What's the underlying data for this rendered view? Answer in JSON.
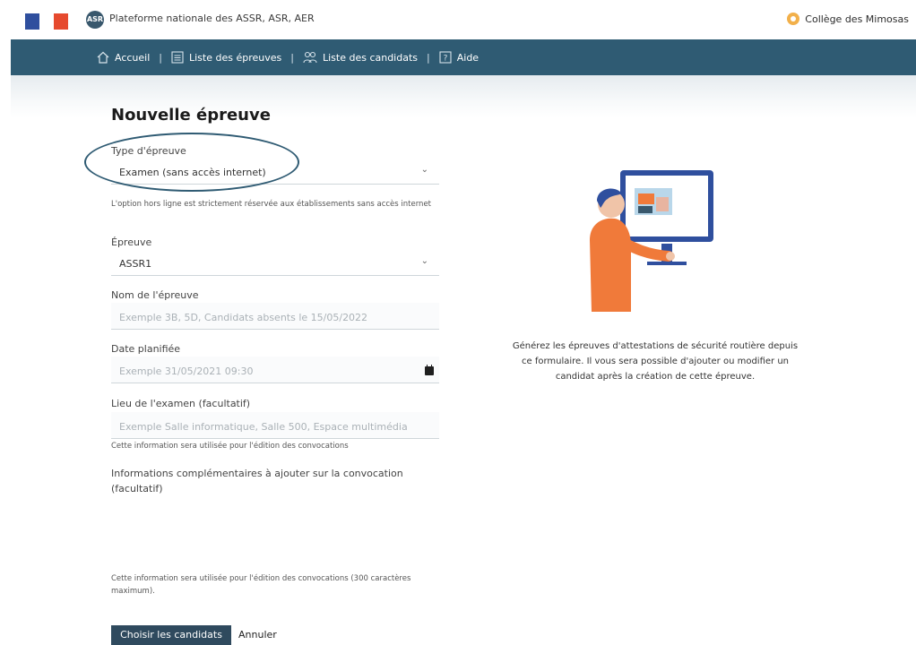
{
  "header": {
    "platform_name": "Plateforme nationale des ASSR, ASR, AER",
    "logo_text": "ASR",
    "school_name": "Collège des Mimosas"
  },
  "nav": {
    "items": [
      {
        "label": "Accueil",
        "icon": "home-icon"
      },
      {
        "label": "Liste des épreuves",
        "icon": "list-icon"
      },
      {
        "label": "Liste des candidats",
        "icon": "users-icon"
      },
      {
        "label": "Aide",
        "icon": "help-icon"
      }
    ],
    "separator": "|"
  },
  "form": {
    "title": "Nouvelle épreuve",
    "type": {
      "label": "Type d'épreuve",
      "value": "Examen (sans accès internet)",
      "hint": "L'option hors ligne est strictement réservée aux établissements sans accès internet"
    },
    "epreuve": {
      "label": "Épreuve",
      "value": "ASSR1"
    },
    "nom": {
      "label": "Nom de l'épreuve",
      "placeholder": "Exemple 3B, 5D, Candidats absents le 15/05/2022"
    },
    "date": {
      "label": "Date planifiée",
      "placeholder": "Exemple 31/05/2021 09:30"
    },
    "lieu": {
      "label": "Lieu de l'examen (facultatif)",
      "placeholder": "Exemple Salle informatique, Salle 500, Espace multimédia",
      "hint": "Cette information sera utilisée pour l'édition des convocations"
    },
    "infos": {
      "label": "Informations complémentaires à ajouter sur la convocation (facultatif)",
      "hint": "Cette information sera utilisée pour l'édition des convocations (300 caractères maximum)."
    },
    "submit_label": "Choisir les candidats",
    "cancel_label": "Annuler"
  },
  "aside": {
    "caption": "Générez les épreuves d'attestations de sécurité routière depuis ce formulaire. Il vous sera possible d'ajouter ou modifier un candidat après la création de cette épreuve."
  },
  "colors": {
    "nav_bg": "#2f5b73",
    "primary_button": "#2f4a5e",
    "accent_orange": "#f07a3a"
  }
}
